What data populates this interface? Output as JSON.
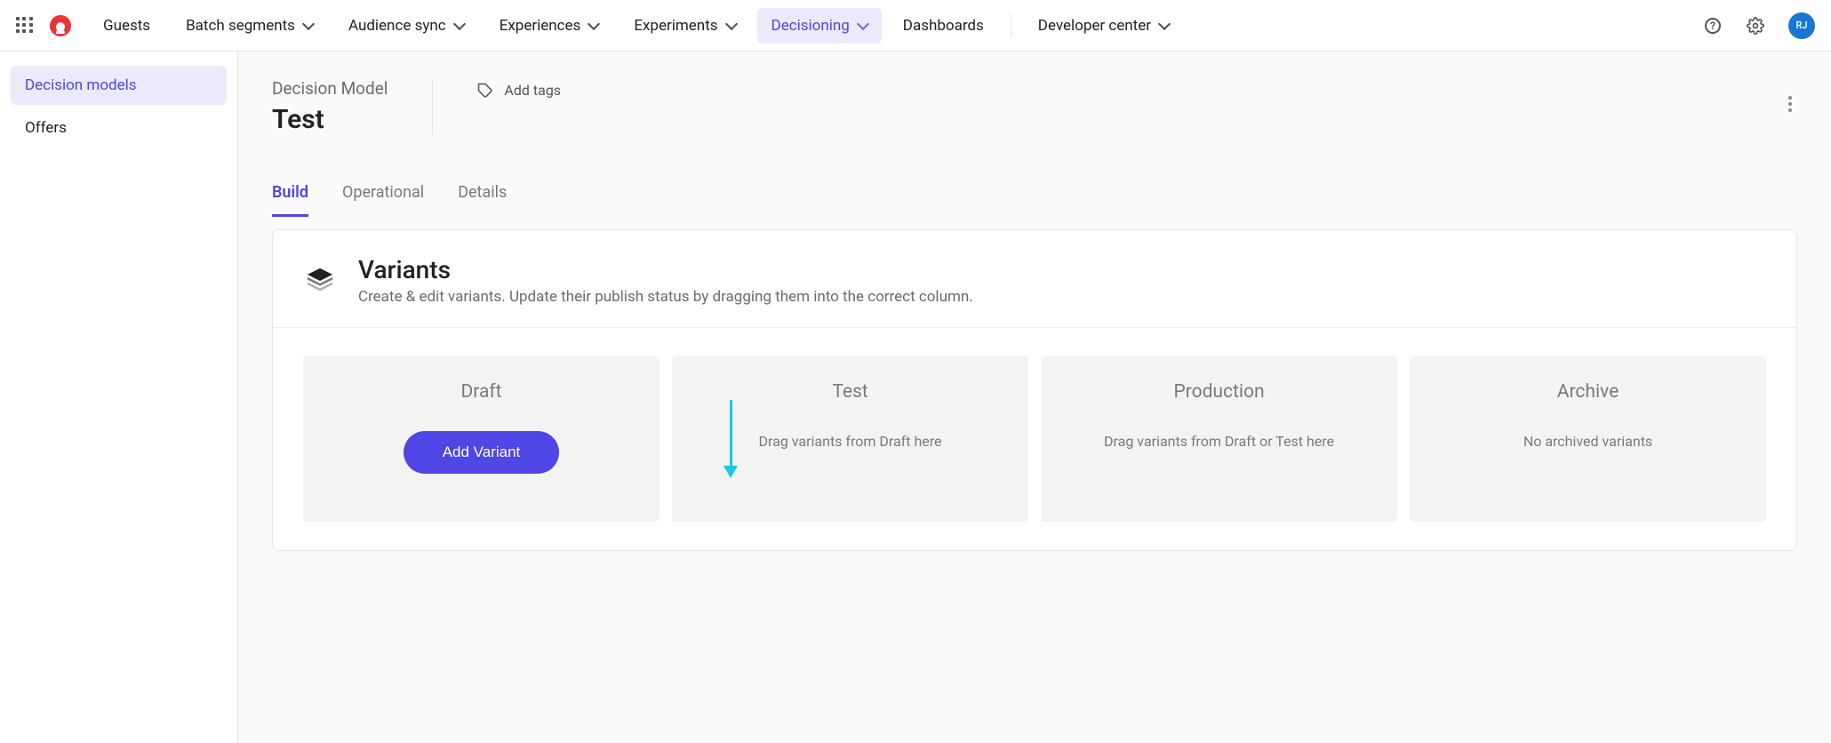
{
  "nav": {
    "items": [
      {
        "label": "Guests",
        "dropdown": false
      },
      {
        "label": "Batch segments",
        "dropdown": true
      },
      {
        "label": "Audience sync",
        "dropdown": true
      },
      {
        "label": "Experiences",
        "dropdown": true
      },
      {
        "label": "Experiments",
        "dropdown": true
      },
      {
        "label": "Decisioning",
        "dropdown": true,
        "active": true
      },
      {
        "label": "Dashboards",
        "dropdown": false
      },
      {
        "label": "Developer center",
        "dropdown": true
      }
    ],
    "avatar_initials": "RJ"
  },
  "sidebar": {
    "items": [
      {
        "label": "Decision models",
        "active": true
      },
      {
        "label": "Offers",
        "active": false
      }
    ]
  },
  "header": {
    "breadcrumb": "Decision Model",
    "title": "Test",
    "add_tags": "Add tags"
  },
  "tabs": [
    {
      "label": "Build",
      "active": true
    },
    {
      "label": "Operational",
      "active": false
    },
    {
      "label": "Details",
      "active": false
    }
  ],
  "variants_card": {
    "title": "Variants",
    "subtitle": "Create & edit variants. Update their publish status by dragging them into the correct column.",
    "columns": {
      "draft": {
        "title": "Draft",
        "button": "Add Variant"
      },
      "test": {
        "title": "Test",
        "hint": "Drag variants from Draft here"
      },
      "production": {
        "title": "Production",
        "hint": "Drag variants from Draft or Test here"
      },
      "archive": {
        "title": "Archive",
        "hint": "No archived variants"
      }
    }
  }
}
